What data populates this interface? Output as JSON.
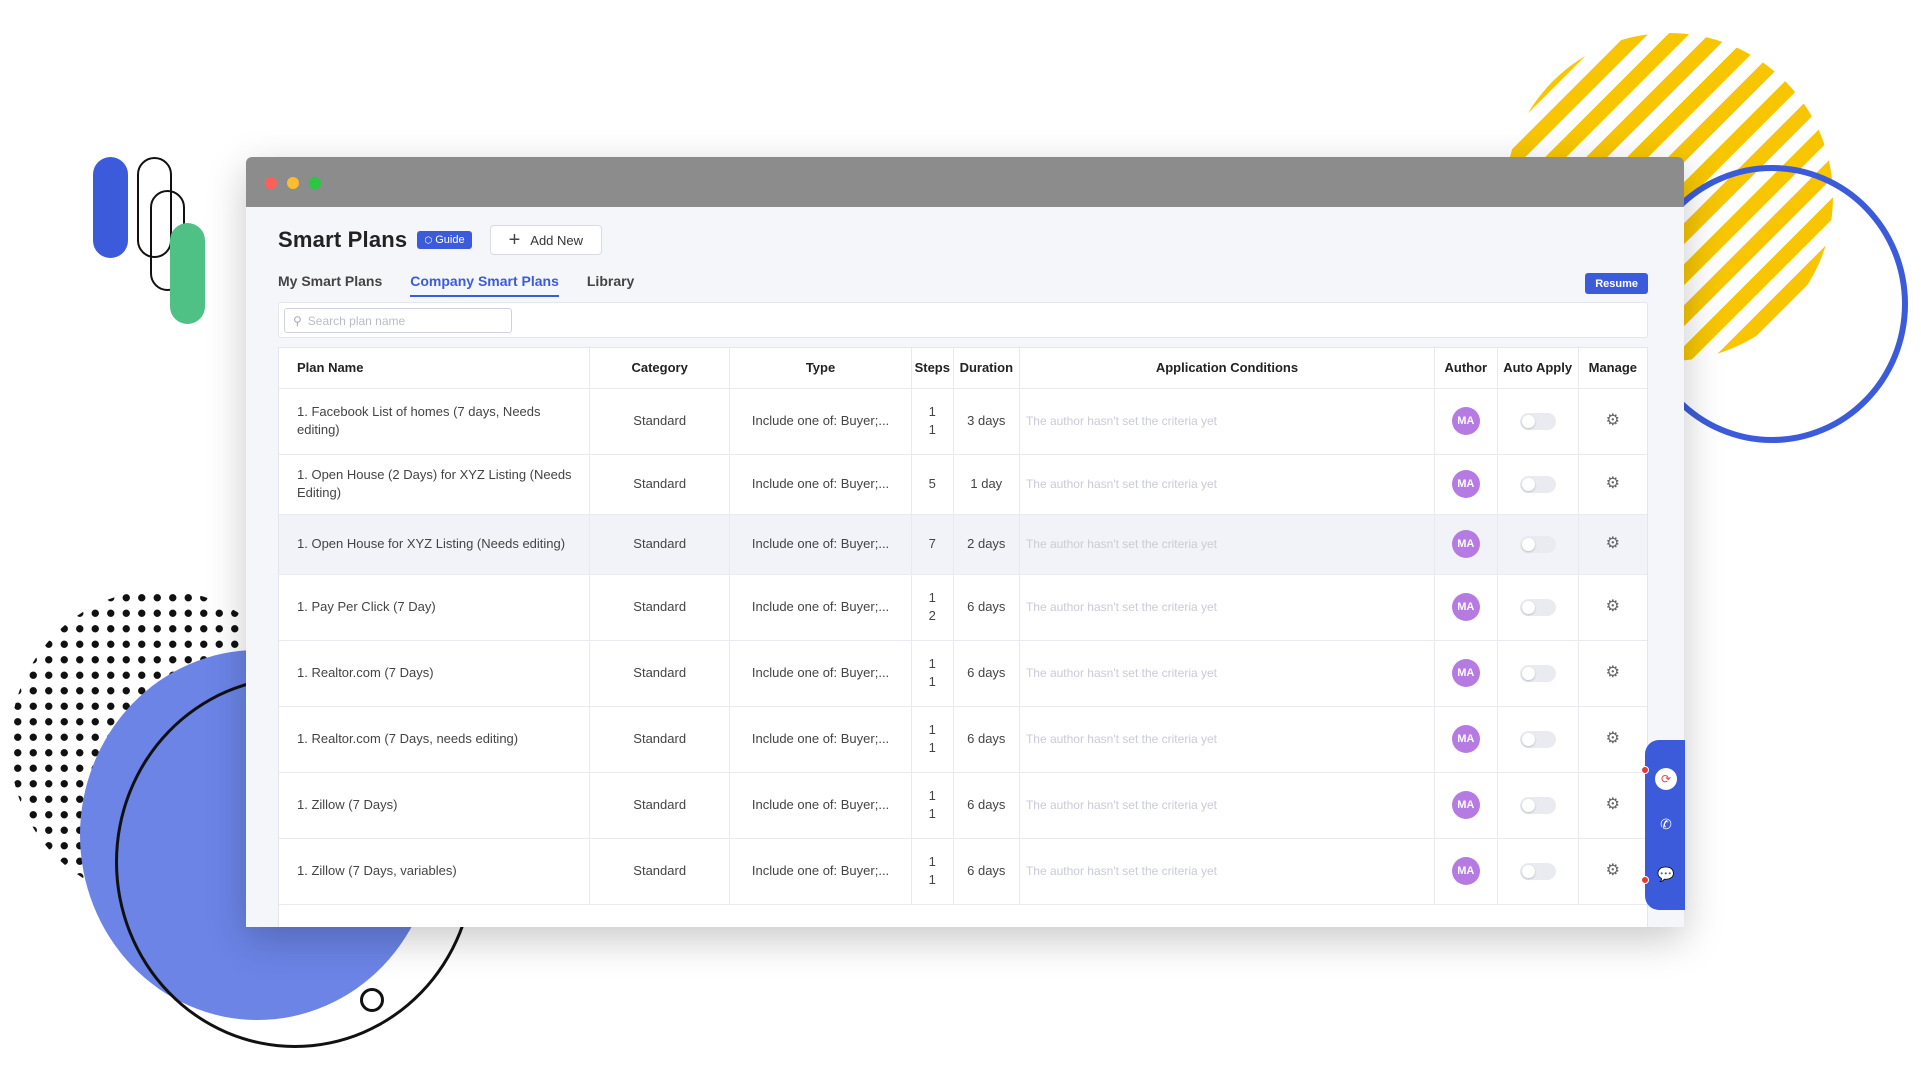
{
  "window": {
    "title": "Smart Plans"
  },
  "header": {
    "title": "Smart Plans",
    "guide_label": "Guide",
    "add_new_label": "Add New",
    "resume_label": "Resume"
  },
  "tabs": [
    {
      "label": "My Smart Plans",
      "active": false
    },
    {
      "label": "Company Smart Plans",
      "active": true
    },
    {
      "label": "Library",
      "active": false
    }
  ],
  "search": {
    "placeholder": "Search plan name"
  },
  "table": {
    "columns": [
      "Plan Name",
      "Category",
      "Type",
      "Steps",
      "Duration",
      "Application Conditions",
      "Author",
      "Auto Apply",
      "Manage"
    ],
    "rows": [
      {
        "name": "1. Facebook List of homes (7 days, Needs editing)",
        "category": "Standard",
        "type": "Include one of: Buyer;...",
        "steps": "1\n1",
        "duration": "3 days",
        "conditions": "The author hasn't set the criteria yet",
        "author": "MA"
      },
      {
        "name": "1. Open House (2 Days) for XYZ Listing (Needs Editing)",
        "category": "Standard",
        "type": "Include one of: Buyer;...",
        "steps": "5",
        "duration": "1 day",
        "conditions": "The author hasn't set the criteria yet",
        "author": "MA"
      },
      {
        "name": "1. Open House for XYZ Listing (Needs editing)",
        "category": "Standard",
        "type": "Include one of: Buyer;...",
        "steps": "7",
        "duration": "2 days",
        "conditions": "The author hasn't set the criteria yet",
        "author": "MA"
      },
      {
        "name": "1. Pay Per Click (7 Day)",
        "category": "Standard",
        "type": "Include one of: Buyer;...",
        "steps": "1\n2",
        "duration": "6 days",
        "conditions": "The author hasn't set the criteria yet",
        "author": "MA"
      },
      {
        "name": "1. Realtor.com (7 Days)",
        "category": "Standard",
        "type": "Include one of: Buyer;...",
        "steps": "1\n1",
        "duration": "6 days",
        "conditions": "The author hasn't set the criteria yet",
        "author": "MA"
      },
      {
        "name": "1. Realtor.com (7 Days, needs editing)",
        "category": "Standard",
        "type": "Include one of: Buyer;...",
        "steps": "1\n1",
        "duration": "6 days",
        "conditions": "The author hasn't set the criteria yet",
        "author": "MA"
      },
      {
        "name": "1. Zillow (7 Days)",
        "category": "Standard",
        "type": "Include one of: Buyer;...",
        "steps": "1\n1",
        "duration": "6 days",
        "conditions": "The author hasn't set the criteria yet",
        "author": "MA"
      },
      {
        "name": "1. Zillow (7 Days, variables)",
        "category": "Standard",
        "type": "Include one of: Buyer;...",
        "steps": "1\n1",
        "duration": "6 days",
        "conditions": "The author hasn't set the criteria yet",
        "author": "MA"
      }
    ]
  },
  "icons": {
    "search": "search-icon",
    "gear": "gear-icon",
    "plus": "plus-icon",
    "phone": "phone-icon",
    "chat": "chat-icon"
  },
  "colors": {
    "accent": "#3b5bdb",
    "avatar": "#b57be3"
  }
}
